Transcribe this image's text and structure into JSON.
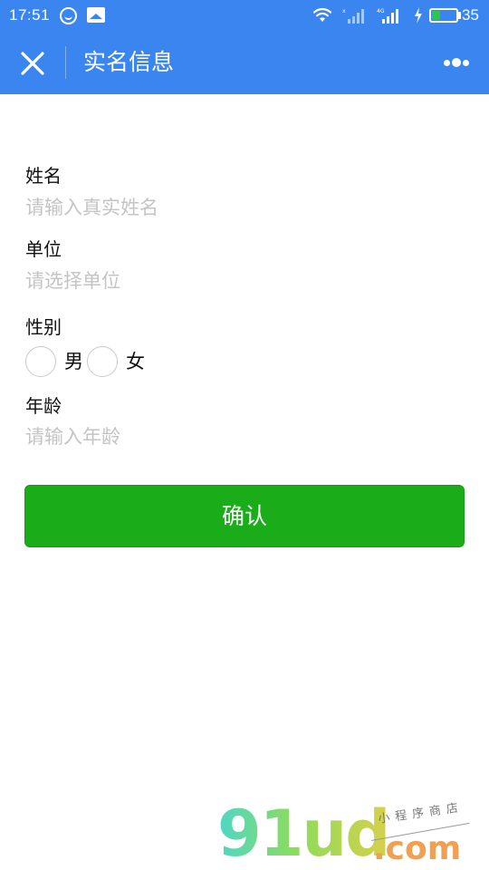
{
  "status_bar": {
    "time": "17:51",
    "battery_level": "35",
    "battery_fraction": 0.35,
    "icons": [
      "app-notification-icon",
      "image-notification-icon",
      "wifi-icon",
      "signal-icon-sim1",
      "signal-icon-sim2-4g",
      "charging-icon",
      "battery-icon"
    ]
  },
  "nav": {
    "title": "实名信息"
  },
  "form": {
    "name": {
      "label": "姓名",
      "placeholder": "请输入真实姓名"
    },
    "unit": {
      "label": "单位",
      "placeholder": "请选择单位"
    },
    "gender": {
      "label": "性别",
      "options": [
        "男",
        "女"
      ]
    },
    "age": {
      "label": "年龄",
      "placeholder": "请输入年龄"
    },
    "confirm_label": "确认"
  },
  "watermark": {
    "logo": "91ud",
    "suffix": ".com",
    "tagline": "小程序商店"
  },
  "colors": {
    "header_blue": "#3a85f0",
    "confirm_green": "#1aad19",
    "placeholder_gray": "#c4c4c4"
  }
}
